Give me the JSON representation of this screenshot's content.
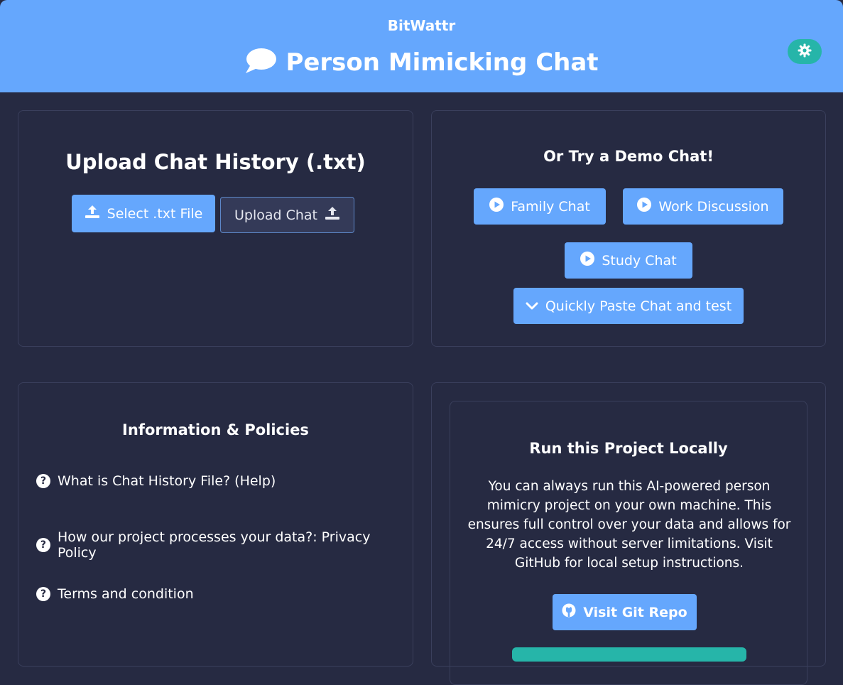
{
  "header": {
    "brand": "BitWattr",
    "title": "Person Mimicking Chat",
    "icons": {
      "title": "speech-bubble-icon",
      "theme_toggle": "gear-icon"
    }
  },
  "upload": {
    "heading": "Upload Chat History (.txt)",
    "select_label": "Select .txt File",
    "upload_label": "Upload Chat"
  },
  "demo": {
    "heading": "Or Try a Demo Chat!",
    "buttons": [
      "Family Chat",
      "Work Discussion",
      "Study Chat"
    ],
    "paste_label": "Quickly Paste Chat and test"
  },
  "info": {
    "heading": "Information & Policies",
    "items": [
      "What is Chat History File? (Help)",
      "How our project processes your data?: Privacy Policy",
      "Terms and condition"
    ]
  },
  "local": {
    "heading": "Run this Project Locally",
    "description": "You can always run this AI-powered person mimicry project on your own machine. This ensures full control over your data and allows for 24/7 access without server limitations. Visit GitHub for local setup instructions.",
    "repo_label": "Visit Git Repo"
  },
  "colors": {
    "header_bg": "#65a7fd",
    "page_bg": "#262a42",
    "accent": "#65a7fd",
    "toggle_bg": "#26b5a9"
  }
}
